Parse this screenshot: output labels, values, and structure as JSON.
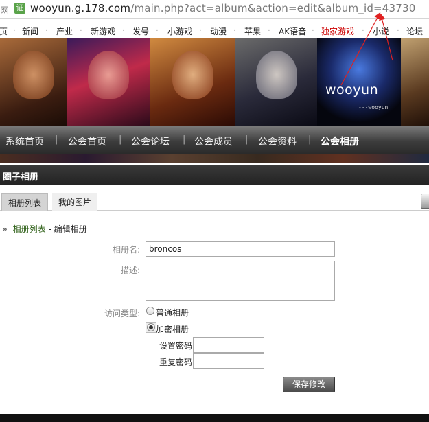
{
  "urlbar": {
    "left_fragment": "网",
    "cert_label": "证",
    "url_host": "wooyun.g.178.com",
    "url_rest": "/main.php?act=album&action=edit&album_id=43730"
  },
  "site_nav": {
    "items": [
      {
        "label": "页"
      },
      {
        "label": "新闻"
      },
      {
        "label": "产业"
      },
      {
        "label": "新游戏"
      },
      {
        "label": "发号"
      },
      {
        "label": "小游戏"
      },
      {
        "label": "动漫"
      },
      {
        "label": "苹果"
      },
      {
        "label": "AK语音"
      },
      {
        "label": "独家游戏"
      },
      {
        "label": "小说"
      },
      {
        "label": "论坛"
      }
    ],
    "hot_color": "#cc0000"
  },
  "banner": {
    "brand": "wooyun",
    "brand_sub": "---wooyun"
  },
  "guild_nav": {
    "items": [
      {
        "label": "系统首页"
      },
      {
        "label": "公会首页"
      },
      {
        "label": "公会论坛"
      },
      {
        "label": "公会成员"
      },
      {
        "label": "公会资料"
      },
      {
        "label": "公会相册"
      }
    ],
    "active": "公会相册"
  },
  "section_title": "圈子相册",
  "tabs": [
    {
      "label": "相册列表",
      "active": true
    },
    {
      "label": "我的图片",
      "active": false
    }
  ],
  "breadcrumb": {
    "link": "相册列表",
    "separator": "-",
    "current": "编辑相册"
  },
  "form": {
    "name_label": "相册名:",
    "name_value": "broncos",
    "desc_label": "描述:",
    "desc_value": "",
    "access_label": "访问类型:",
    "access_options": [
      {
        "label": "普通相册",
        "checked": false
      },
      {
        "label": "加密相册",
        "checked": true
      }
    ],
    "set_pwd_label": "设置密码",
    "repeat_pwd_label": "重复密码",
    "set_pwd_value": "",
    "repeat_pwd_value": "",
    "submit_label": "保存修改"
  },
  "colors": {
    "accent_link": "#2d5f16",
    "nav_dark": "#2b2b2b",
    "annotation_red": "#e02020"
  }
}
